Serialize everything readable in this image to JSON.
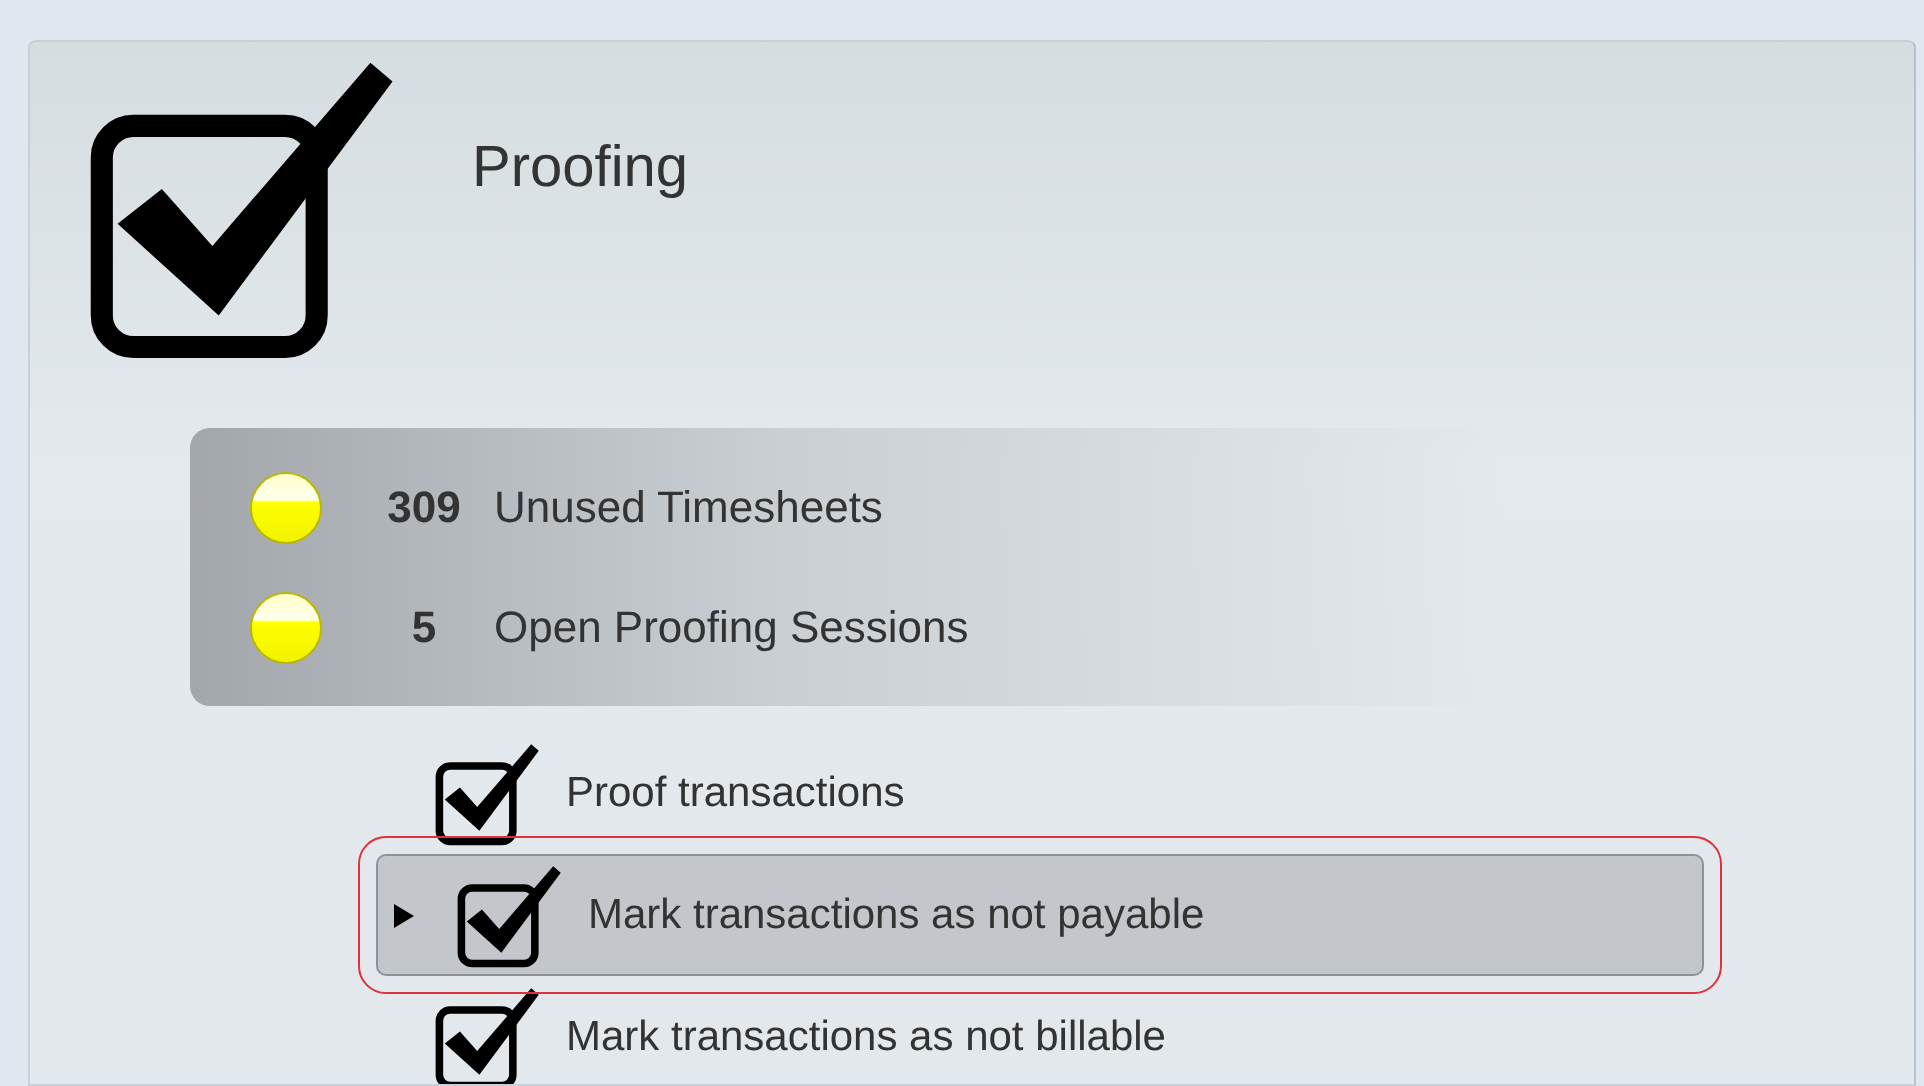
{
  "title": "Proofing",
  "indicators": [
    {
      "count": "309",
      "label": "Unused Timesheets"
    },
    {
      "count": "5",
      "label": "Open Proofing Sessions"
    }
  ],
  "tasks": [
    {
      "label": "Proof transactions",
      "selected": false
    },
    {
      "label": "Mark transactions as not payable",
      "selected": true
    },
    {
      "label": "Mark transactions as not billable",
      "selected": false
    }
  ]
}
